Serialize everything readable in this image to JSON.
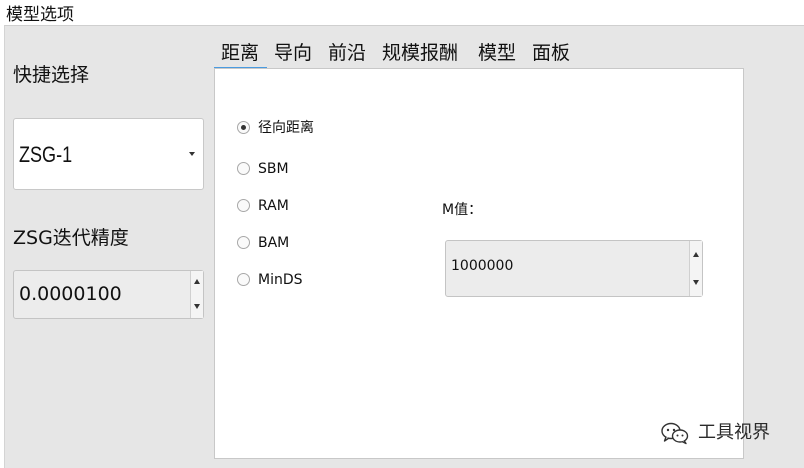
{
  "groupbox": {
    "title": "模型选项"
  },
  "quick_select": {
    "label": "快捷选择",
    "value": "ZSG-1"
  },
  "precision": {
    "label": "ZSG迭代精度",
    "value": "0.0000100"
  },
  "tabs": [
    {
      "label": "距离",
      "active": true
    },
    {
      "label": "导向",
      "active": false
    },
    {
      "label": "前沿",
      "active": false
    },
    {
      "label": "规模报酬",
      "active": false
    },
    {
      "label": "模型",
      "active": false
    },
    {
      "label": "面板",
      "active": false
    }
  ],
  "distance_options": [
    {
      "label": "径向距离",
      "checked": true
    },
    {
      "label": "SBM",
      "checked": false
    },
    {
      "label": "RAM",
      "checked": false
    },
    {
      "label": "BAM",
      "checked": false
    },
    {
      "label": "MinDS",
      "checked": false
    }
  ],
  "m_value": {
    "label": "M值：",
    "value": "1000000"
  },
  "watermark": {
    "text": "工具视界",
    "icon": "wechat-icon"
  }
}
